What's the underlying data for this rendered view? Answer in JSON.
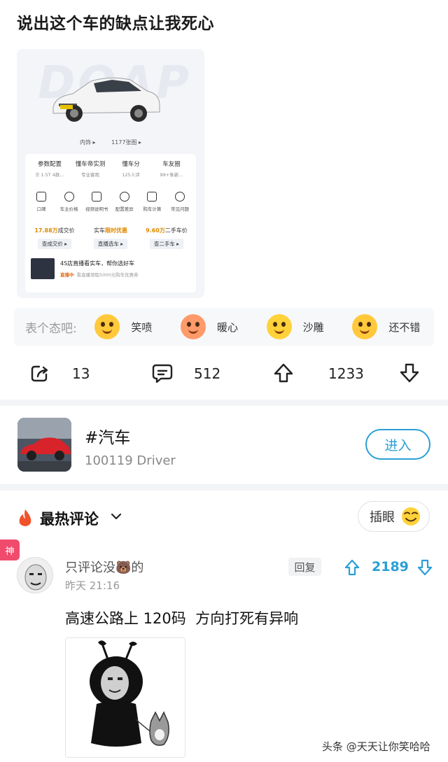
{
  "post": {
    "title": "说出这个车的缺点让我死心",
    "image": {
      "bg_text": "DOAP",
      "links": [
        "内饰 ▸",
        "1177张图 ▸"
      ],
      "stats": [
        {
          "title": "参数配置",
          "sub": "☰ 1.5T 4款..."
        },
        {
          "title": "懂车帝实测",
          "sub": "专业客观"
        },
        {
          "title": "懂车分",
          "sub": "125人评"
        },
        {
          "title": "车友圈",
          "sub": "99+条新..."
        }
      ],
      "icons": [
        "口碑",
        "车主价格",
        "视频说明书",
        "配置差异",
        "购车计算",
        "常见问题"
      ],
      "prices": [
        {
          "pre": "17.88万",
          "post": "成交价",
          "btn": "查成交价 ▸"
        },
        {
          "pre": "实车",
          "post": "限时优惠",
          "btn": "直播选车 ▸"
        },
        {
          "pre": "9.60万",
          "post": "二手车价",
          "btn": "查二手车 ▸"
        }
      ],
      "live": {
        "title": "4S店直播看实车，帮你选好车",
        "status": "直播中",
        "desc": "· 看直播领取5000元购车优惠券"
      }
    }
  },
  "reactions": {
    "label": "表个态吧:",
    "items": [
      {
        "name": "笑喷",
        "icon": "laughing-tears-icon",
        "color": "#ffc93b"
      },
      {
        "name": "暖心",
        "icon": "heart-hug-icon",
        "color": "#ff9a6a"
      },
      {
        "name": "沙雕",
        "icon": "silly-face-icon",
        "color": "#ffd23a"
      },
      {
        "name": "还不错",
        "icon": "smirk-face-icon",
        "color": "#ffc93b"
      }
    ]
  },
  "actions": {
    "share_count": "13",
    "comment_count": "512",
    "upvote_count": "1233"
  },
  "topic": {
    "title": "#汽车",
    "subtitle": "100119 Driver",
    "enter_label": "进入"
  },
  "comments": {
    "header": "最热评论",
    "insert_label": "插眼",
    "items": [
      {
        "badge": "神",
        "username": "只评论没🐻的",
        "time": "昨天 21:16",
        "reply_label": "回复",
        "likes": "2189",
        "text": "高速公路上 120码  方向打死有异响"
      }
    ]
  },
  "watermark": "头条 @天天让你笑哈哈",
  "colors": {
    "accent": "#2a9fd6",
    "badge": "#f04b6c",
    "fire": "#f0532a"
  }
}
